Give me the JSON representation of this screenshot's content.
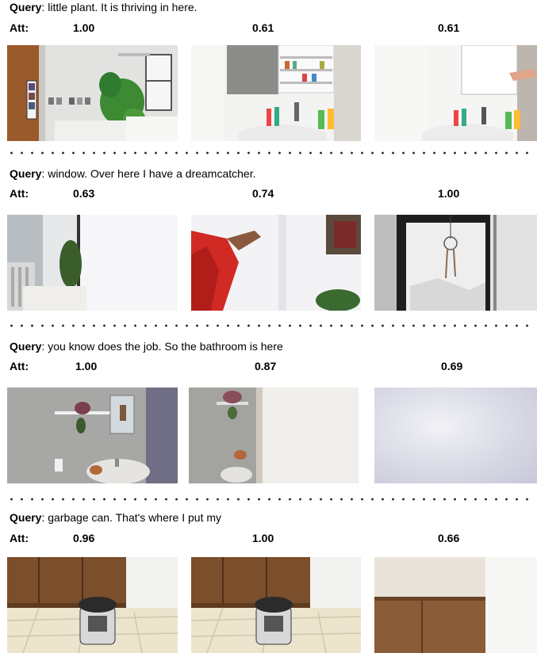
{
  "att_label": "Att",
  "query_label": "Query",
  "rows": [
    {
      "query": "little plant. It is thriving in here.",
      "att": [
        "1.00",
        "0.61",
        "0.61"
      ],
      "frames": [
        {
          "desc": "bathroom-wall-with-hanging-plant",
          "colors": [
            "#9b5a2c",
            "#e4e4e2",
            "#2f7b30"
          ]
        },
        {
          "desc": "medicine-cabinet-and-sink",
          "colors": [
            "#f3f3f1",
            "#8c8c88",
            "#d6c4b2"
          ]
        },
        {
          "desc": "shower-curtain-and-sink",
          "colors": [
            "#f5f5f3",
            "#bdb6ae",
            "#6b5c4e"
          ]
        }
      ]
    },
    {
      "query": "window. Over here I have a dreamcatcher.",
      "att": [
        "0.63",
        "0.74",
        "1.00"
      ],
      "frames": [
        {
          "desc": "window-with-plant-and-radiator",
          "colors": [
            "#b8bdc2",
            "#f4f4f6",
            "#3b5d2a"
          ]
        },
        {
          "desc": "hand-pulling-curtain",
          "colors": [
            "#d12a25",
            "#f3f3f5",
            "#5a4a3c"
          ]
        },
        {
          "desc": "dreamcatcher-in-window",
          "colors": [
            "#2a2a2c",
            "#f0f0f0",
            "#8a6b55"
          ]
        }
      ]
    },
    {
      "query": "you know does the job. So the bathroom is here",
      "att": [
        "1.00",
        "0.87",
        "0.69"
      ],
      "frames": [
        {
          "desc": "bathroom-sink-tiled-wall",
          "colors": [
            "#a9aaa8",
            "#706e84",
            "#d3d1cf"
          ]
        },
        {
          "desc": "blurred-bathroom-door",
          "colors": [
            "#9b9b98",
            "#f0eeeb",
            "#7a6f63"
          ]
        },
        {
          "desc": "blurred-white-wall",
          "colors": [
            "#e6e6f0",
            "#d7d7e4",
            "#f1f1f5"
          ]
        }
      ]
    },
    {
      "query": "garbage can. That's where I put my",
      "att": [
        "0.96",
        "1.00",
        "0.66"
      ],
      "frames": [
        {
          "desc": "kitchen-cabinets-and-trash-can",
          "colors": [
            "#7b4e2c",
            "#ece4cd",
            "#2b2b2b"
          ]
        },
        {
          "desc": "kitchen-cabinets-and-trash-can",
          "colors": [
            "#7b4e2c",
            "#ece4cd",
            "#2b2b2b"
          ]
        },
        {
          "desc": "blurred-kitchen-counter",
          "colors": [
            "#ebe6db",
            "#8a5c38",
            "#f3f1ec"
          ]
        }
      ]
    }
  ]
}
